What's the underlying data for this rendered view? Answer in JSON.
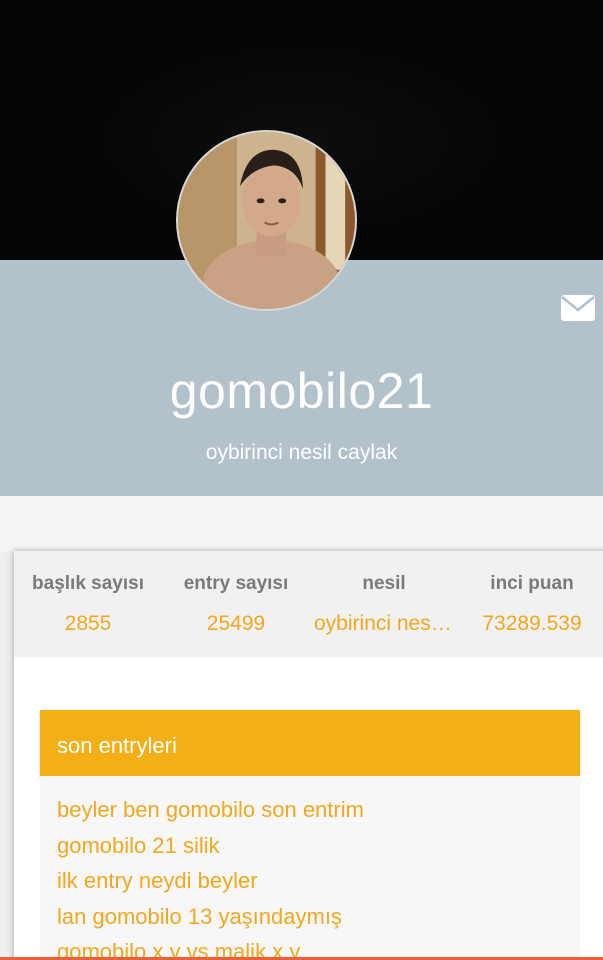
{
  "profile": {
    "username": "gomobilo21",
    "subtitle": "oybirinci nesil caylak"
  },
  "icons": {
    "message": "mail-icon"
  },
  "stats": [
    {
      "label": "başlık sayısı",
      "value": "2855"
    },
    {
      "label": "entry sayısı",
      "value": "25499"
    },
    {
      "label": "nesil",
      "value": "oybirinci nesil caylak"
    },
    {
      "label": "inci puan",
      "value": "73289.539"
    }
  ],
  "recent": {
    "title": "son entryleri",
    "items": [
      "beyler ben gomobilo son entrim",
      "gomobilo 21 silik",
      "ilk entry neydi beyler",
      "lan gomobilo 13 yaşındaymış",
      "gomobilo x y vs malik x y"
    ]
  },
  "colors": {
    "accent": "#f4af17",
    "band": "#b3c1cb",
    "link": "#f2a81d"
  }
}
